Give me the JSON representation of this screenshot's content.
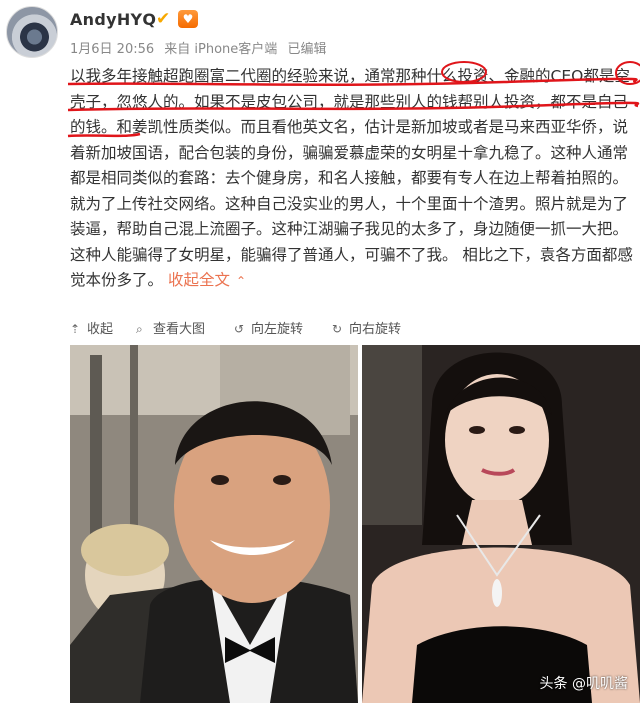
{
  "post": {
    "username": "AndyHYQ",
    "verified_icon": "v-badge-icon",
    "fan_icon": "fan-badge-icon",
    "date": "1月6日 20:56",
    "source": "来自 iPhone客户端",
    "edited": "已编辑",
    "body_part1": "以我多年接触超跑圈富二代圈的经验来说，通常那种什么投资、金融的CEO都是空壳子，忽悠人的。如果不是皮包公司，就是那些别人的钱帮别人投资，都不是自己的钱。和姜凯性质类似。而且看他英文名，估计是新加坡或者是马来西亚华侨，说着新加坡国语，配合包装的身份，骗骗爱慕虚荣的女明星十拿九稳了。这种人通常都是相同类似的套路：去个健身房，和名人接触，都要有专人在边上帮着拍照的。就为了上传社交网络。这种自己没实业的男人，十个里面十个渣男。照片就是为了装逼，帮助自己混上流圈子。这种江湖骗子我见的太多了，身边随便一抓一大把。这种人能骗得了女明星，能骗得了普通人，可骗不了我。 相比之下，袁各方面都感觉本份多了。",
    "collapse_label": "收起全文",
    "collapse_icon": "chevron-up-icon"
  },
  "toolbar": {
    "collapse": "收起",
    "view_large": "查看大图",
    "rotate_left": "向左旋转",
    "rotate_right": "向右旋转"
  },
  "watermark": "头条 @叽叽酱",
  "colors": {
    "link": "#eb7350",
    "underline": "#e0151a"
  }
}
